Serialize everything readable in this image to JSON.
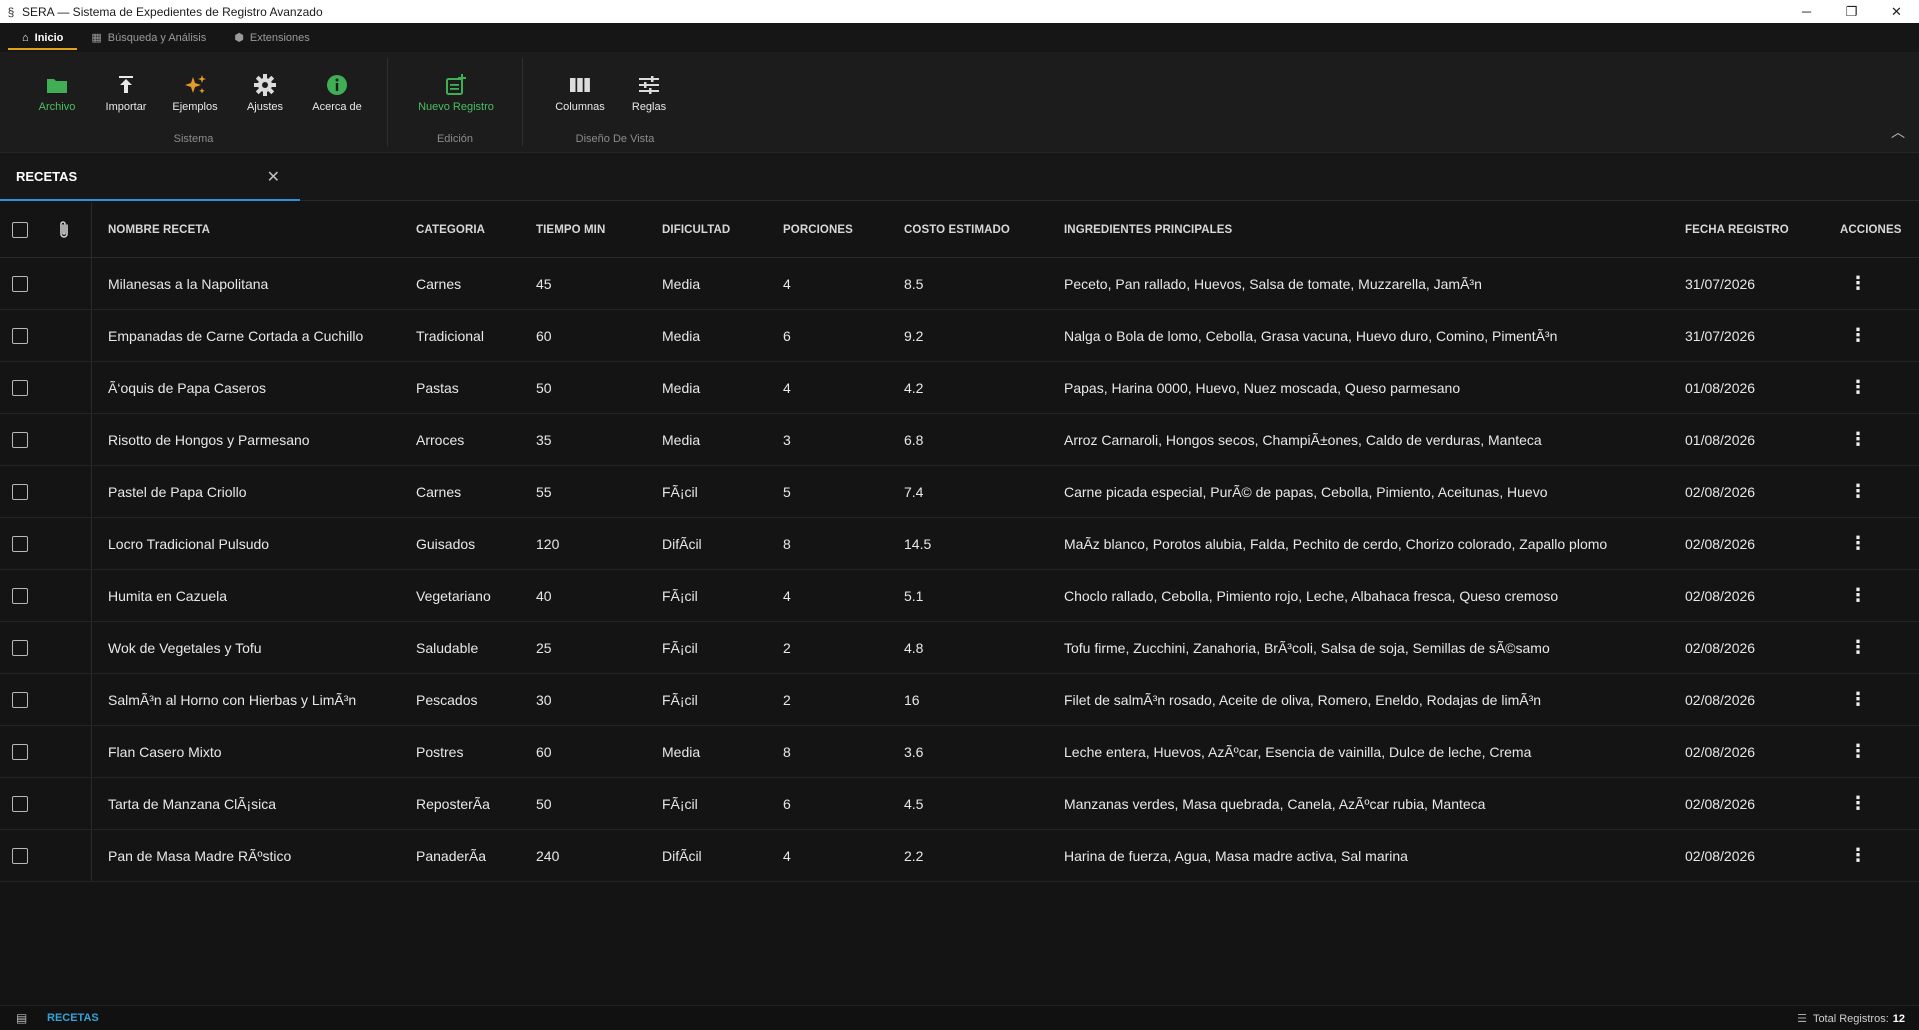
{
  "window": {
    "title": "SERA — Sistema de Expedientes de Registro Avanzado",
    "controls": {
      "minimize": "─",
      "maximize": "❐",
      "close": "✕"
    }
  },
  "ribbon_tabs": [
    {
      "label": "Inicio",
      "icon": "home-icon",
      "glyph": "⌂"
    },
    {
      "label": "Búsqueda y Análisis",
      "icon": "table-icon",
      "glyph": "▦"
    },
    {
      "label": "Extensiones",
      "icon": "puzzle-icon",
      "glyph": "⬢"
    }
  ],
  "ribbon": {
    "groups": {
      "sistema": "Sistema",
      "edicion": "Edición",
      "diseno": "Diseño De Vista"
    },
    "buttons": {
      "archivo": "Archivo",
      "importar": "Importar",
      "ejemplos": "Ejemplos",
      "ajustes": "Ajustes",
      "acerca": "Acerca de",
      "nuevo": "Nuevo Registro",
      "columnas": "Columnas",
      "reglas": "Reglas"
    },
    "colors": {
      "green": "#4bbf62",
      "orange": "#e59a2a",
      "white": "#e8e8e8"
    }
  },
  "doc_tab": {
    "label": "RECETAS",
    "close": "✕"
  },
  "table": {
    "headers": {
      "nombre": "NOMBRE RECETA",
      "categoria": "CATEGORIA",
      "tiempo": "TIEMPO MIN",
      "dificultad": "DIFICULTAD",
      "porciones": "PORCIONES",
      "costo": "COSTO ESTIMADO",
      "ingredientes": "INGREDIENTES PRINCIPALES",
      "fecha": "FECHA REGISTRO",
      "acciones": "ACCIONES"
    },
    "rows": [
      {
        "nombre": "Milanesas a la Napolitana",
        "categoria": "Carnes",
        "tiempo": "45",
        "dificultad": "Media",
        "porciones": "4",
        "costo": "8.5",
        "ingredientes": "Peceto, Pan rallado, Huevos, Salsa de tomate, Muzzarella, JamÃ³n",
        "fecha": "31/07/2026"
      },
      {
        "nombre": "Empanadas de Carne Cortada a Cuchillo",
        "categoria": "Tradicional",
        "tiempo": "60",
        "dificultad": "Media",
        "porciones": "6",
        "costo": "9.2",
        "ingredientes": "Nalga o Bola de lomo, Cebolla, Grasa vacuna, Huevo duro, Comino, PimentÃ³n",
        "fecha": "31/07/2026"
      },
      {
        "nombre": "Ã‘oquis de Papa Caseros",
        "categoria": "Pastas",
        "tiempo": "50",
        "dificultad": "Media",
        "porciones": "4",
        "costo": "4.2",
        "ingredientes": "Papas, Harina 0000, Huevo, Nuez moscada, Queso parmesano",
        "fecha": "01/08/2026"
      },
      {
        "nombre": "Risotto de Hongos y Parmesano",
        "categoria": "Arroces",
        "tiempo": "35",
        "dificultad": "Media",
        "porciones": "3",
        "costo": "6.8",
        "ingredientes": "Arroz Carnaroli, Hongos secos, ChampiÃ±ones, Caldo de verduras, Manteca",
        "fecha": "01/08/2026"
      },
      {
        "nombre": "Pastel de Papa Criollo",
        "categoria": "Carnes",
        "tiempo": "55",
        "dificultad": "FÃ¡cil",
        "porciones": "5",
        "costo": "7.4",
        "ingredientes": "Carne picada especial, PurÃ© de papas, Cebolla, Pimiento, Aceitunas, Huevo",
        "fecha": "02/08/2026"
      },
      {
        "nombre": "Locro Tradicional Pulsudo",
        "categoria": "Guisados",
        "tiempo": "120",
        "dificultad": "DifÃcil",
        "porciones": "8",
        "costo": "14.5",
        "ingredientes": "MaÃz blanco, Porotos alubia, Falda, Pechito de cerdo, Chorizo colorado, Zapallo plomo",
        "fecha": "02/08/2026"
      },
      {
        "nombre": "Humita en Cazuela",
        "categoria": "Vegetariano",
        "tiempo": "40",
        "dificultad": "FÃ¡cil",
        "porciones": "4",
        "costo": "5.1",
        "ingredientes": "Choclo rallado, Cebolla, Pimiento rojo, Leche, Albahaca fresca, Queso cremoso",
        "fecha": "02/08/2026"
      },
      {
        "nombre": "Wok de Vegetales y Tofu",
        "categoria": "Saludable",
        "tiempo": "25",
        "dificultad": "FÃ¡cil",
        "porciones": "2",
        "costo": "4.8",
        "ingredientes": "Tofu firme, Zucchini, Zanahoria, BrÃ³coli, Salsa de soja, Semillas de sÃ©samo",
        "fecha": "02/08/2026"
      },
      {
        "nombre": "SalmÃ³n al Horno con Hierbas y LimÃ³n",
        "categoria": "Pescados",
        "tiempo": "30",
        "dificultad": "FÃ¡cil",
        "porciones": "2",
        "costo": "16",
        "ingredientes": "Filet de salmÃ³n rosado, Aceite de oliva, Romero, Eneldo, Rodajas de limÃ³n",
        "fecha": "02/08/2026"
      },
      {
        "nombre": "Flan Casero Mixto",
        "categoria": "Postres",
        "tiempo": "60",
        "dificultad": "Media",
        "porciones": "8",
        "costo": "3.6",
        "ingredientes": "Leche entera, Huevos, AzÃºcar, Esencia de vainilla, Dulce de leche, Crema",
        "fecha": "02/08/2026"
      },
      {
        "nombre": "Tarta de Manzana ClÃ¡sica",
        "categoria": "ReposterÃa",
        "tiempo": "50",
        "dificultad": "FÃ¡cil",
        "porciones": "6",
        "costo": "4.5",
        "ingredientes": "Manzanas verdes, Masa quebrada, Canela, AzÃºcar rubia, Manteca",
        "fecha": "02/08/2026"
      },
      {
        "nombre": "Pan de Masa Madre RÃºstico",
        "categoria": "PanaderÃa",
        "tiempo": "240",
        "dificultad": "DifÃcil",
        "porciones": "4",
        "costo": "2.2",
        "ingredientes": "Harina de fuerza, Agua, Masa madre activa, Sal marina",
        "fecha": "02/08/2026"
      }
    ]
  },
  "statusbar": {
    "tab": "RECETAS",
    "total_label": "Total Registros:",
    "total_value": "12"
  }
}
